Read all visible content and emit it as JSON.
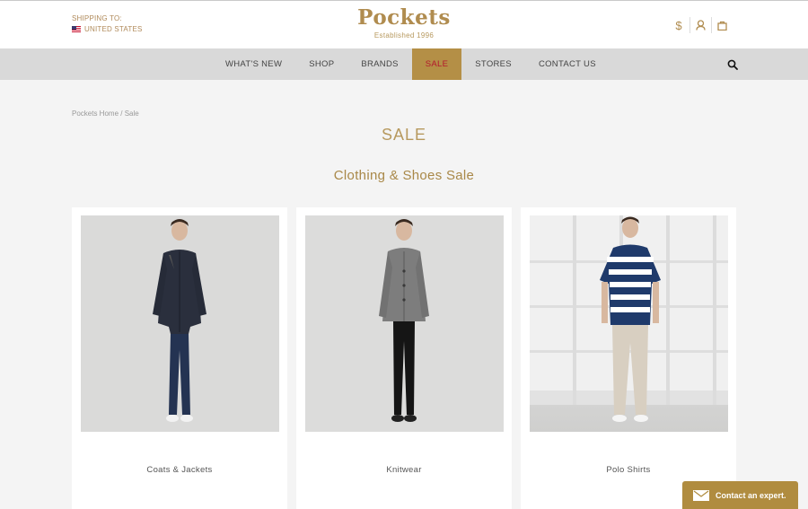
{
  "header": {
    "shipping_label": "SHIPPING TO:",
    "shipping_country": "UNITED STATES",
    "logo": "Pockets",
    "tagline": "Established 1996",
    "icons": [
      "currency-dollar-icon",
      "account-icon",
      "shopping-bag-icon"
    ],
    "currency_symbol": "$"
  },
  "nav": {
    "items": [
      {
        "label": "WHAT'S NEW"
      },
      {
        "label": "SHOP"
      },
      {
        "label": "BRANDS"
      },
      {
        "label": "SALE"
      },
      {
        "label": "STORES"
      },
      {
        "label": "CONTACT US"
      }
    ],
    "active": "SALE"
  },
  "breadcrumb": {
    "home": "Pockets Home",
    "separator": " / ",
    "current": "Sale"
  },
  "page": {
    "title": "SALE",
    "section_title": "Clothing & Shoes Sale"
  },
  "categories": [
    {
      "label": "Coats & Jackets"
    },
    {
      "label": "Knitwear"
    },
    {
      "label": "Polo Shirts"
    }
  ],
  "contact": {
    "label": "Contact an expert."
  },
  "colors": {
    "brand_gold": "#b08c4f",
    "nav_background": "#d9d9d9",
    "active_tab": "#b48f46",
    "active_tab_text": "#b3182d",
    "page_background": "#f4f4f4"
  }
}
